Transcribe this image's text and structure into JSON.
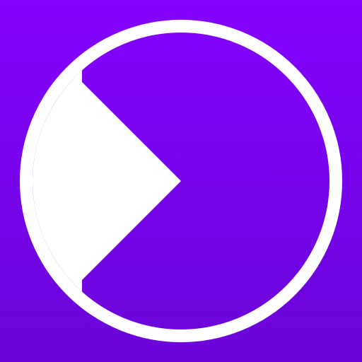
{
  "icon": {
    "name": "play-circle-logo-icon",
    "colors": {
      "background_top": "#8402fe",
      "background_bottom": "#6a05d8",
      "foreground": "#ffffff"
    }
  }
}
